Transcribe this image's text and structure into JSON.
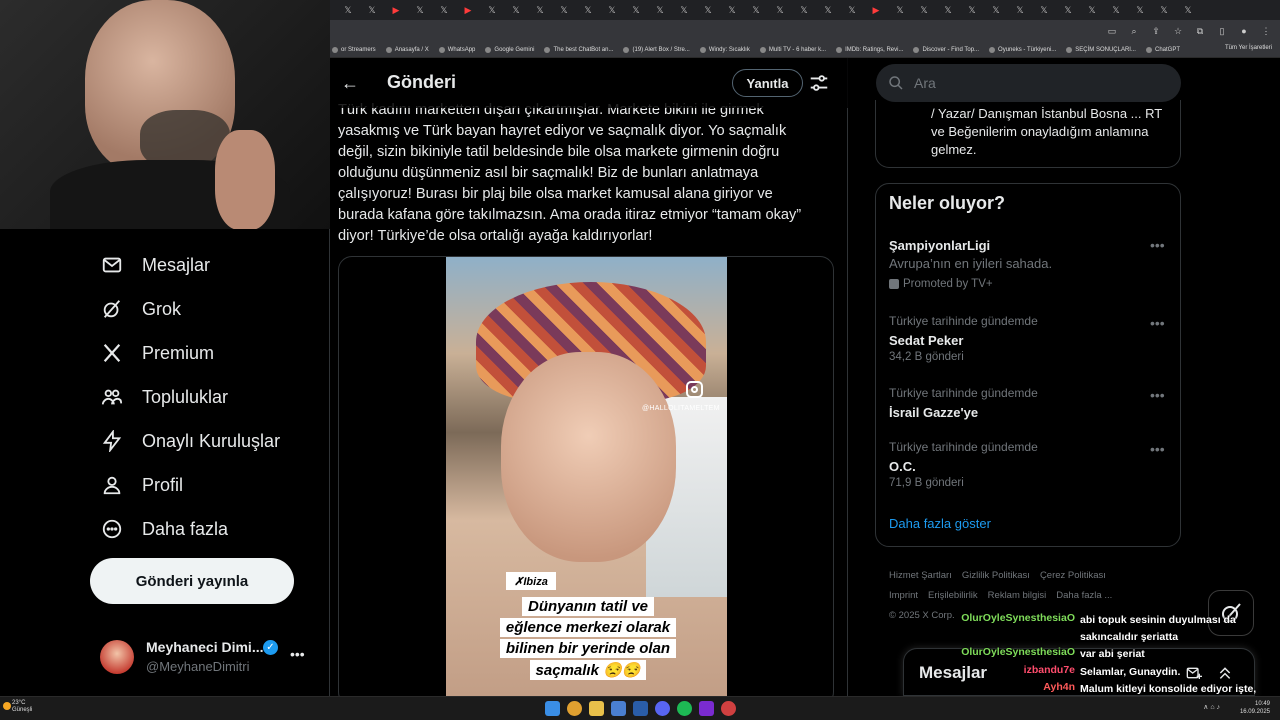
{
  "browser": {
    "tabs_count": 36,
    "bookmarks": [
      "or Streamers",
      "Anasayfa / X",
      "WhatsApp",
      "Google Gemini",
      "The best ChatBot an...",
      "(19) Alert Box / Stre...",
      "Windy: Sıcaklık",
      "Multi TV - 6 haber k...",
      "IMDb: Ratings, Revi...",
      "Discover - Find Top...",
      "Oyuneks - Türkiyeni...",
      "SEÇİM SONUÇLARI...",
      "ChatGPT"
    ],
    "bookmarks_folder": "Tüm Yer İşaretleri"
  },
  "nav": {
    "items": [
      {
        "label": "Mesajlar",
        "icon": "envelope-icon"
      },
      {
        "label": "Grok",
        "icon": "grok-icon"
      },
      {
        "label": "Premium",
        "icon": "x-logo-icon"
      },
      {
        "label": "Topluluklar",
        "icon": "people-icon"
      },
      {
        "label": "Onaylı Kuruluşlar",
        "icon": "lightning-icon"
      },
      {
        "label": "Profil",
        "icon": "person-icon"
      },
      {
        "label": "Daha fazla",
        "icon": "more-circle-icon"
      }
    ],
    "post_button": "Gönderi yayınla",
    "profile_name": "Meyhaneci Dimi...",
    "profile_handle": "@MeyhaneDimitri",
    "profile_more": "•••"
  },
  "header": {
    "title": "Gönderi",
    "reply_button": "Yanıtla"
  },
  "tweet": {
    "lines": [
      "Türk kadını marketten dışarı çıkartmışlar. Markete bikini ile girmek",
      "yasakmış ve Türk bayan hayret ediyor ve saçmalık diyor. Yo saçmalık",
      "değil, sizin bikiniyle tatil beldesinde bile olsa markete girmenin doğru",
      "olduğunu düşünmeniz asıl bir saçmalık! Biz de bunları anlatmaya",
      "çalışıyoruz! Burası bir plaj bile olsa market kamusal alana giriyor ve",
      "burada kafana göre takılmazsın. Ama orada itiraz etmiyor “tamam okay”",
      "diyor! Türkiye’de olsa ortalığı ayağa kaldırıyorlar!"
    ],
    "video": {
      "ig_handle": "@HALLOLITAMELTEM",
      "tag": "✗Ibiza",
      "caption": [
        "Dünyanın tatil ve",
        "eğlence merkezi olarak",
        "bilinen bir yerinde olan",
        "saçmalık 😒😒"
      ]
    }
  },
  "sidebar": {
    "search_placeholder": "Ara",
    "bio": "/ Yazar/ Danışman İstanbul Bosna ... RT ve Beğenilerim onayladığım anlamına gelmez.",
    "trends_title": "Neler oluyor?",
    "trends": [
      {
        "context": "",
        "name": "ŞampiyonlarLigi",
        "sub": "Avrupa’nın en iyileri sahada.",
        "count": "",
        "promo": "Promoted by TV+"
      },
      {
        "context": "Türkiye tarihinde gündemde",
        "name": "Sedat Peker",
        "sub": "",
        "count": "34,2 B gönderi",
        "promo": ""
      },
      {
        "context": "Türkiye tarihinde gündemde",
        "name": "İsrail Gazze'ye",
        "sub": "",
        "count": "",
        "promo": ""
      },
      {
        "context": "Türkiye tarihinde gündemde",
        "name": "O.C.",
        "sub": "",
        "count": "71,9 B gönderi",
        "promo": ""
      }
    ],
    "trend_more": "•••",
    "show_more": "Daha fazla göster",
    "footer": [
      "Hizmet Şartları",
      "Gizlilik Politikası",
      "Çerez Politikası",
      "Imprint",
      "Erişilebilirlik",
      "Reklam bilgisi",
      "Daha fazla ...",
      "© 2025 X Corp."
    ]
  },
  "messages_drawer": {
    "title": "Mesajlar"
  },
  "chat": [
    {
      "user": "OlurOyleSynesthesiaO",
      "color": "#7fdc5a",
      "text": "abi topuk sesinin duyulması da"
    },
    {
      "user": "",
      "color": "#7fdc5a",
      "text": "sakıncalıdır şeriatta"
    },
    {
      "user": "OlurOyleSynesthesiaO",
      "color": "#7fdc5a",
      "text": "var abi şeriat"
    },
    {
      "user": "izbandu7e",
      "color": "#ff4d6d",
      "text": "Selamlar, Gunaydin."
    },
    {
      "user": "Ayh4n",
      "color": "#ff5a5a",
      "text": "Malum kitleyi konsolide ediyor işte,"
    },
    {
      "user": "",
      "color": "#ff5a5a",
      "text": "baya da planlı gibi görünüyor."
    }
  ],
  "taskbar": {
    "weather_temp": "23°C",
    "weather_desc": "Güneşli",
    "time": "10:49",
    "date": "16.09.2025"
  }
}
